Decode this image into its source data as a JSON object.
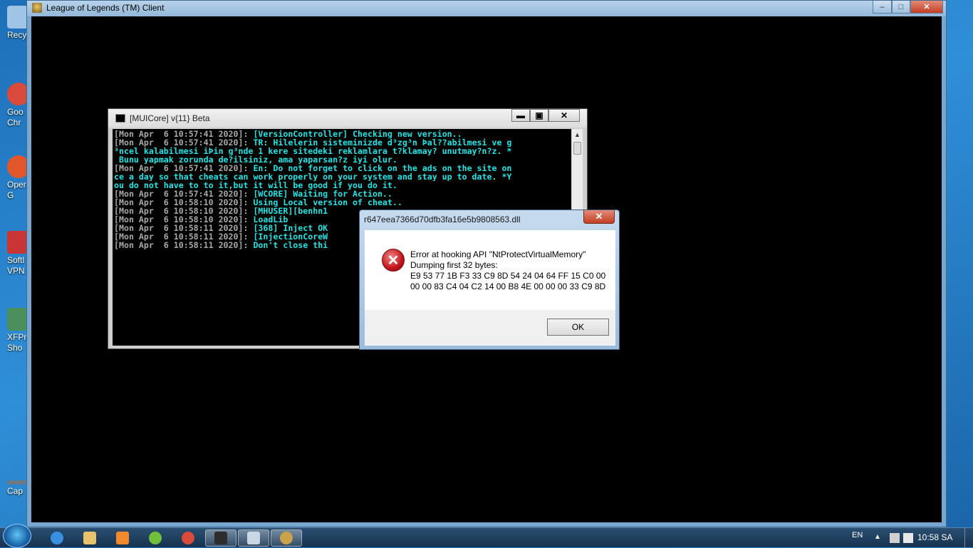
{
  "desktop": {
    "icons": [
      {
        "label": "Recyc",
        "icon": "recycle-bin-icon",
        "color": "#9fc4e6"
      },
      {
        "label": "Goo\nChr",
        "icon": "chrome-icon",
        "color": "#d94a3a"
      },
      {
        "label": "Oper\nG",
        "icon": "opera-gx-icon",
        "color": "#e2562b"
      },
      {
        "label": "Softl\nVPN",
        "icon": "softether-vpn-icon",
        "color": "#c93535"
      },
      {
        "label": "XFPr\nSho",
        "icon": "xfpro-icon",
        "color": "#4a8f5c"
      },
      {
        "label": "Cap",
        "icon": "capture-icon",
        "color": "#6c7a87"
      }
    ]
  },
  "lol_window": {
    "title": "League of Legends (TM) Client",
    "buttons": {
      "minimize": "‒",
      "maximize": "□",
      "close": "✕"
    }
  },
  "console": {
    "title": "[MUICore] v{11} Beta",
    "buttons": {
      "minimize": "▬",
      "maximize": "▣",
      "close": "✕"
    },
    "lines": [
      {
        "ts": "[Mon Apr  6 10:57:41 2020]: ",
        "msg": "[VersionController] Checking new version.."
      },
      {
        "ts": "[Mon Apr  6 10:57:41 2020]: ",
        "msg": "TR: Hilelerin sisteminizde d³zg³n Þal??abilmesi ve g"
      },
      {
        "ts": "",
        "msg": "³ncel kalabilmesi iÞin g³nde 1 kere sitedeki reklamlara t?klamay? unutmay?n?z. *"
      },
      {
        "ts": "",
        "msg": " Bunu yapmak zorunda de?ilsiniz, ama yaparsan?z iyi olur."
      },
      {
        "ts": "[Mon Apr  6 10:57:41 2020]: ",
        "msg": "En: Do not forget to click on the ads on the site on"
      },
      {
        "ts": "",
        "msg": "ce a day so that cheats can work properly on your system and stay up to date. *Y"
      },
      {
        "ts": "",
        "msg": "ou do not have to to it,but it will be good if you do it."
      },
      {
        "ts": "[Mon Apr  6 10:57:41 2020]: ",
        "msg": "[WCORE] Waiting for Action.."
      },
      {
        "ts": "[Mon Apr  6 10:58:10 2020]: ",
        "msg": "Using Local version of cheat.."
      },
      {
        "ts": "[Mon Apr  6 10:58:10 2020]: ",
        "msg": "[MHUSER][benhn1"
      },
      {
        "ts": "[Mon Apr  6 10:58:10 2020]: ",
        "msg": "LoadLib"
      },
      {
        "ts": "[Mon Apr  6 10:58:11 2020]: ",
        "msg": "[368] Inject OK"
      },
      {
        "ts": "[Mon Apr  6 10:58:11 2020]: ",
        "msg": "[InjectionCoreW"
      },
      {
        "ts": "[Mon Apr  6 10:58:11 2020]: ",
        "msg": "Don't close thi"
      }
    ]
  },
  "dialog": {
    "title": "r647eea7366d70dfb3fa16e5b9808563.dll",
    "close_label": "✕",
    "icon": "error-icon",
    "icon_glyph": "✕",
    "message_lines": [
      "Error at hooking API \"NtProtectVirtualMemory\"",
      "Dumping first 32 bytes:",
      "E9 53 77 1B F3 33 C9 8D 54 24 04 64 FF 15 C0 00",
      "00 00 83 C4 04 C2 14 00 B8 4E 00 00 00 33 C9 8D"
    ],
    "ok_label": "OK"
  },
  "taskbar": {
    "items": [
      {
        "name": "ie-taskbar-icon",
        "color": "#3b8fe0",
        "active": false
      },
      {
        "name": "explorer-taskbar-icon",
        "color": "#e8c36a",
        "active": false
      },
      {
        "name": "media-player-taskbar-icon",
        "color": "#f08a2c",
        "active": false
      },
      {
        "name": "utorrent-taskbar-icon",
        "color": "#6fbf3a",
        "active": false
      },
      {
        "name": "chrome-taskbar-icon",
        "color": "#d94a3a",
        "active": false
      },
      {
        "name": "console-taskbar-icon",
        "color": "#2d2d2d",
        "active": true
      },
      {
        "name": "window-taskbar-icon",
        "color": "#c9d6e4",
        "active": true
      },
      {
        "name": "league-taskbar-icon",
        "color": "#c9a24a",
        "active": true
      }
    ],
    "language": "EN",
    "clock": "10:58 SA"
  }
}
